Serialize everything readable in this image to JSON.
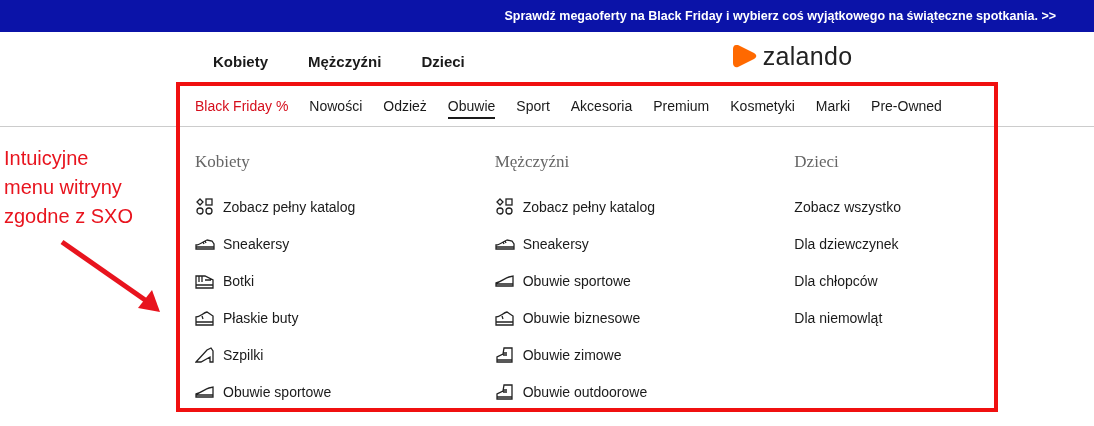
{
  "banner": {
    "text": "Sprawdź megaoferty na Black Friday i wybierz coś wyjątkowego na świąteczne spotkania. >>"
  },
  "gender_nav": [
    "Kobiety",
    "Mężczyźni",
    "Dzieci"
  ],
  "logo": {
    "text": "zalando"
  },
  "categories": [
    {
      "label": "Black Friday %",
      "kind": "promo",
      "selected": false
    },
    {
      "label": "Nowości",
      "kind": "normal",
      "selected": false
    },
    {
      "label": "Odzież",
      "kind": "normal",
      "selected": false
    },
    {
      "label": "Obuwie",
      "kind": "normal",
      "selected": true
    },
    {
      "label": "Sport",
      "kind": "normal",
      "selected": false
    },
    {
      "label": "Akcesoria",
      "kind": "normal",
      "selected": false
    },
    {
      "label": "Premium",
      "kind": "normal",
      "selected": false
    },
    {
      "label": "Kosmetyki",
      "kind": "normal",
      "selected": false
    },
    {
      "label": "Marki",
      "kind": "normal",
      "selected": false
    },
    {
      "label": "Pre-Owned",
      "kind": "normal",
      "selected": false
    }
  ],
  "menu_columns": [
    {
      "heading": "Kobiety",
      "items": [
        {
          "label": "Zobacz pełny katalog",
          "kind": "catalog"
        },
        {
          "label": "Sneakersy",
          "kind": "sneaker"
        },
        {
          "label": "Botki",
          "kind": "ankle"
        },
        {
          "label": "Płaskie buty",
          "kind": "flat"
        },
        {
          "label": "Szpilki",
          "kind": "heel"
        },
        {
          "label": "Obuwie sportowe",
          "kind": "sport"
        }
      ]
    },
    {
      "heading": "Mężczyźni",
      "items": [
        {
          "label": "Zobacz pełny katalog",
          "kind": "catalog"
        },
        {
          "label": "Sneakersy",
          "kind": "sneaker"
        },
        {
          "label": "Obuwie sportowe",
          "kind": "sport"
        },
        {
          "label": "Obuwie biznesowe",
          "kind": "flat"
        },
        {
          "label": "Obuwie zimowe",
          "kind": "boot"
        },
        {
          "label": "Obuwie outdoorowe",
          "kind": "boot"
        }
      ]
    },
    {
      "heading": "Dzieci",
      "items": [
        {
          "label": "Zobacz wszystko",
          "kind": "text"
        },
        {
          "label": "Dla dziewczynek",
          "kind": "text"
        },
        {
          "label": "Dla chłopców",
          "kind": "text"
        },
        {
          "label": "Dla niemowląt",
          "kind": "text"
        }
      ]
    }
  ],
  "annotation": {
    "text": "Intuicyjne menu witryny zgodne z SXO"
  }
}
